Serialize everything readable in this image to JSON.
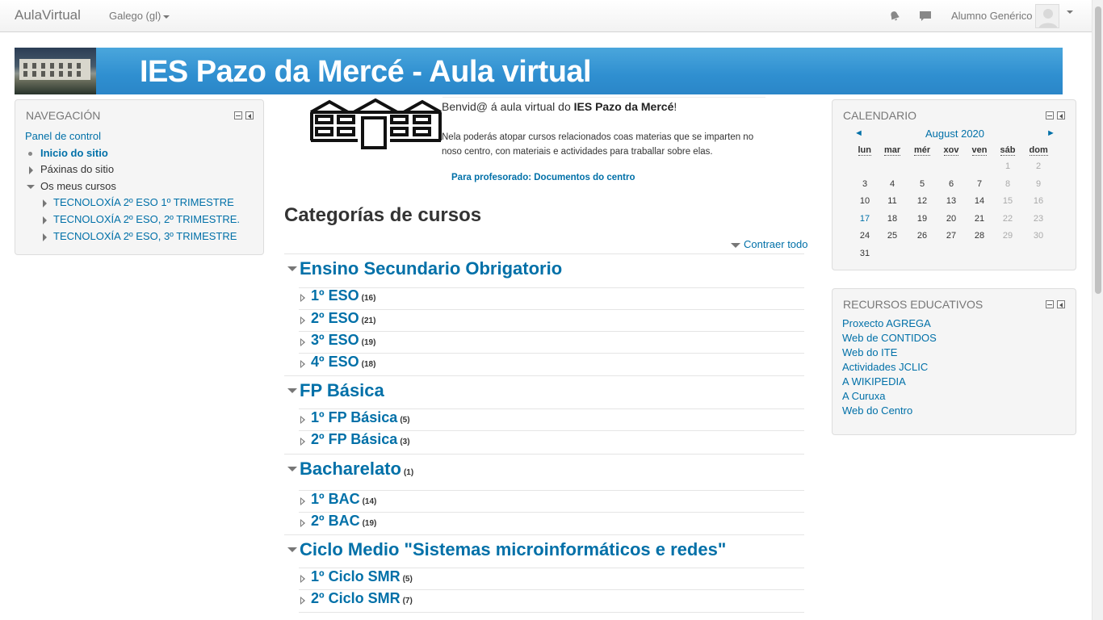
{
  "navbar": {
    "brand": "AulaVirtual",
    "language": "Galego (gl)",
    "user_name": "Alumno Genérico",
    "icons": [
      "notifications-icon",
      "messages-icon"
    ]
  },
  "banner": {
    "title": "IES Pazo da Mercé - Aula virtual"
  },
  "navigation": {
    "title": "NAVEGACIÓN",
    "dashboard": "Panel de control",
    "site_home": "Inicio do sitio",
    "site_pages": "Páxinas do sitio",
    "my_courses": "Os meus cursos",
    "courses": [
      "TECNOLOXÍA 2º ESO 1º TRIMESTRE",
      "TECNOLOXÍA 2º ESO, 2º TRIMESTRE.",
      "TECNOLOXÍA 2º ESO, 3º TRIMESTRE"
    ]
  },
  "calendar": {
    "title": "CALENDARIO",
    "month": "August 2020",
    "prev": "◄",
    "next": "►",
    "weekdays": [
      "lun",
      "mar",
      "mér",
      "xov",
      "ven",
      "sáb",
      "dom"
    ],
    "days": [
      "1",
      "2",
      "3",
      "4",
      "5",
      "6",
      "7",
      "8",
      "9",
      "10",
      "11",
      "12",
      "13",
      "14",
      "15",
      "16",
      "17",
      "18",
      "19",
      "20",
      "21",
      "22",
      "23",
      "24",
      "25",
      "26",
      "27",
      "28",
      "29",
      "30",
      "31"
    ],
    "today": "17"
  },
  "resources": {
    "title": "RECURSOS EDUCATIVOS",
    "links": [
      "Proxecto AGREGA",
      "Web de CONTIDOS",
      "Web do ITE",
      "Actividades JCLIC",
      "A WIKIPEDIA",
      "A Curuxa",
      "Web do Centro"
    ]
  },
  "main": {
    "welcome_prefix": "Benvid@ á aula virtual do ",
    "welcome_school": "IES Pazo da Mercé",
    "welcome_suffix": "!",
    "intro": "Nela poderás atopar cursos relacionados coas materias que se imparten no noso centro, con materiais e actividades para traballar sobre elas.",
    "teacher_link": "Para profesorado: Documentos do centro",
    "categories_title": "Categorías de cursos",
    "collapse_all": "Contraer todo",
    "categories": [
      {
        "name": "Ensino Secundario Obrigatorio",
        "count": "",
        "subs": [
          {
            "name": "1º ESO",
            "count": "(16)"
          },
          {
            "name": "2º ESO",
            "count": "(21)"
          },
          {
            "name": "3º ESO",
            "count": "(19)"
          },
          {
            "name": "4º ESO",
            "count": "(18)"
          }
        ]
      },
      {
        "name": "FP Básica",
        "count": "",
        "subs": [
          {
            "name": "1º FP Básica",
            "count": "(5)"
          },
          {
            "name": "2º FP Básica",
            "count": "(3)"
          }
        ]
      },
      {
        "name": "Bacharelato",
        "count": "(1)",
        "subs": [
          {
            "name": "1º BAC",
            "count": "(14)"
          },
          {
            "name": "2º BAC",
            "count": "(19)"
          }
        ]
      },
      {
        "name": "Ciclo Medio \"Sistemas microinformáticos e redes\"",
        "count": "",
        "subs": [
          {
            "name": "1º Ciclo SMR",
            "count": "(5)"
          },
          {
            "name": "2º Ciclo SMR",
            "count": "(7)"
          }
        ]
      }
    ]
  }
}
